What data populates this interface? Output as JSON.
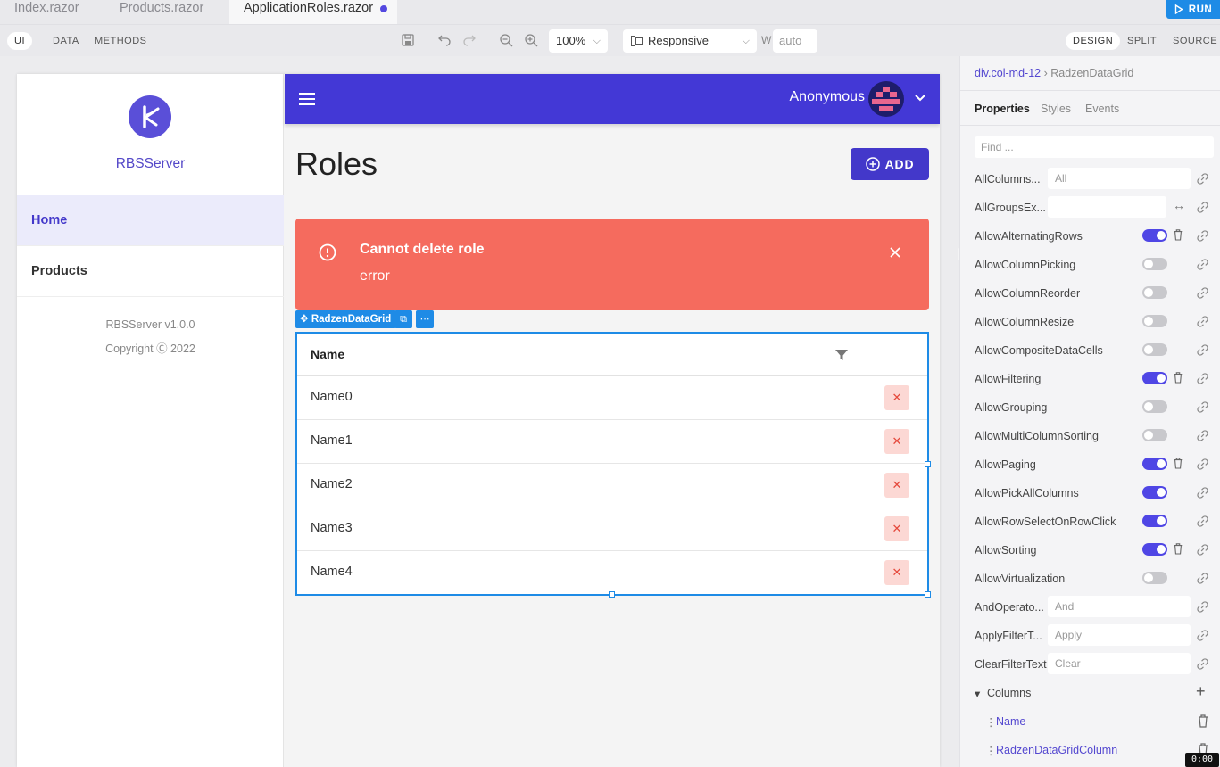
{
  "tabs": [
    {
      "label": "Index.razor",
      "active": false
    },
    {
      "label": "Products.razor",
      "active": false
    },
    {
      "label": "ApplicationRoles.razor",
      "active": true,
      "modified": true
    }
  ],
  "run_label": "RUN",
  "toolbar": {
    "modes": [
      "UI",
      "DATA",
      "METHODS"
    ],
    "active_mode": "UI",
    "zoom": "100%",
    "viewport": "Responsive",
    "width_label": "W",
    "width_placeholder": "auto",
    "views": [
      "DESIGN",
      "SPLIT",
      "SOURCE"
    ],
    "active_view": "DESIGN"
  },
  "app": {
    "brand": "RBSServer",
    "nav": [
      {
        "label": "Home",
        "active": true
      },
      {
        "label": "Products",
        "active": false
      }
    ],
    "version": "RBSServer v1.0.0",
    "copyright": "Copyright Ⓒ 2022",
    "user": "Anonymous",
    "page_title": "Roles",
    "add_label": "ADD",
    "alert": {
      "title": "Cannot delete role",
      "message": "error",
      "color": "#f56b5e"
    },
    "component_tag": "RadzenDataGrid",
    "grid": {
      "column_header": "Name",
      "rows": [
        "Name0",
        "Name1",
        "Name2",
        "Name3",
        "Name4"
      ]
    }
  },
  "panel": {
    "breadcrumb": [
      "div.col-md-12",
      "RadzenDataGrid"
    ],
    "tabs": [
      "Properties",
      "Styles",
      "Events"
    ],
    "active_tab": "Properties",
    "find_placeholder": "Find ...",
    "properties": [
      {
        "label": "AllColumns...",
        "kind": "input",
        "value": "All"
      },
      {
        "label": "AllGroupsEx...",
        "kind": "input-arrows",
        "value": ""
      },
      {
        "label": "AllowAlternatingRows",
        "kind": "toggle",
        "on": true,
        "trash": true
      },
      {
        "label": "AllowColumnPicking",
        "kind": "toggle",
        "on": false
      },
      {
        "label": "AllowColumnReorder",
        "kind": "toggle",
        "on": false
      },
      {
        "label": "AllowColumnResize",
        "kind": "toggle",
        "on": false
      },
      {
        "label": "AllowCompositeDataCells",
        "kind": "toggle",
        "on": false
      },
      {
        "label": "AllowFiltering",
        "kind": "toggle",
        "on": true,
        "trash": true
      },
      {
        "label": "AllowGrouping",
        "kind": "toggle",
        "on": false
      },
      {
        "label": "AllowMultiColumnSorting",
        "kind": "toggle",
        "on": false
      },
      {
        "label": "AllowPaging",
        "kind": "toggle",
        "on": true,
        "trash": true
      },
      {
        "label": "AllowPickAllColumns",
        "kind": "toggle",
        "on": true
      },
      {
        "label": "AllowRowSelectOnRowClick",
        "kind": "toggle",
        "on": true
      },
      {
        "label": "AllowSorting",
        "kind": "toggle",
        "on": true,
        "trash": true
      },
      {
        "label": "AllowVirtualization",
        "kind": "toggle",
        "on": false
      },
      {
        "label": "AndOperato...",
        "kind": "input",
        "value": "And"
      },
      {
        "label": "ApplyFilterT...",
        "kind": "input",
        "value": "Apply"
      },
      {
        "label": "ClearFilterText",
        "kind": "input",
        "value": "Clear"
      }
    ],
    "columns_label": "Columns",
    "columns": [
      "Name",
      "RadzenDataGridColumn"
    ]
  },
  "kbd_hint": "0:00",
  "colors": {
    "accent": "#4338ca",
    "selection": "#1e8be6"
  }
}
